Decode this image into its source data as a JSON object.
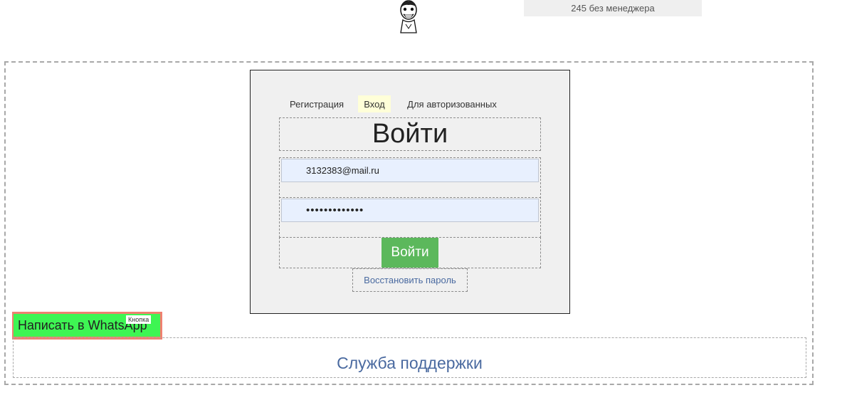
{
  "header": {
    "banner_text": "245 без менеджера"
  },
  "tabs": [
    {
      "label": "Регистрация",
      "active": false
    },
    {
      "label": "Вход",
      "active": true
    },
    {
      "label": "Для авторизованных",
      "active": false
    }
  ],
  "login": {
    "title": "Войти",
    "email_value": "3132383@mail.ru",
    "password_value": "•••••••••••••",
    "submit_label": "Войти",
    "restore_label": "Восстановить пароль"
  },
  "whatsapp": {
    "button_label": "Написать в WhatsApp",
    "badge": "Кнопка"
  },
  "support": {
    "title": "Служба поддержки"
  },
  "colors": {
    "submit_bg": "#5cb85c",
    "whatsapp_bg": "#3ef553",
    "whatsapp_outline": "#f08070",
    "link": "#4a6aa0",
    "active_tab_bg": "#ffffd8",
    "input_bg": "#e8f0fe"
  }
}
